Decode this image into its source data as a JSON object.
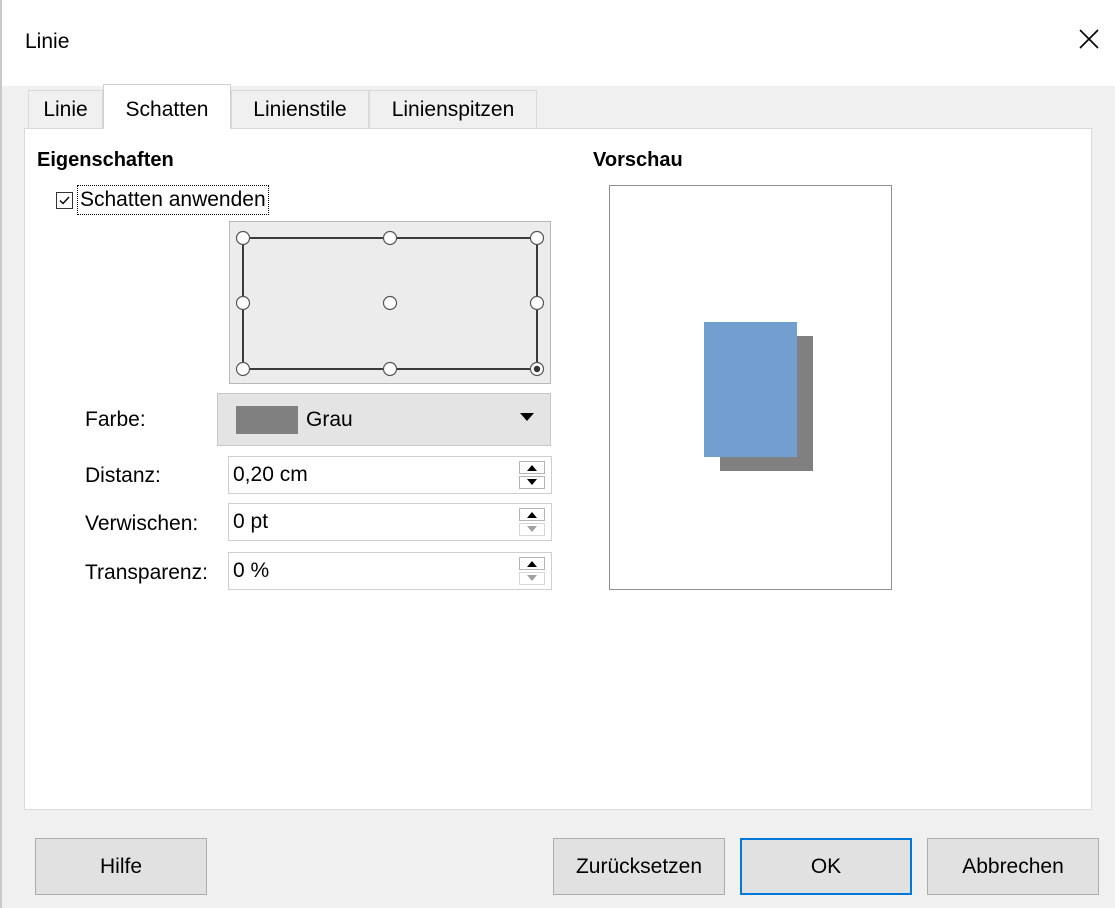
{
  "window": {
    "title": "Linie"
  },
  "tabs": [
    "Linie",
    "Schatten",
    "Linienstile",
    "Linienspitzen"
  ],
  "active_tab": "Schatten",
  "properties": {
    "heading": "Eigenschaften",
    "apply_shadow_label": "Schatten anwenden",
    "apply_shadow_checked": true,
    "position_selected": "bottom-right",
    "color_label": "Farbe:",
    "color_value": "Grau",
    "color_swatch": "#808080",
    "distance_label": "Distanz:",
    "distance_value": "0,20 cm",
    "blur_label": "Verwischen:",
    "blur_value": "0 pt",
    "transparency_label": "Transparenz:",
    "transparency_value": "0 %"
  },
  "preview": {
    "heading": "Vorschau",
    "shape_color": "#729fcf",
    "shadow_color": "#808080"
  },
  "buttons": {
    "help": "Hilfe",
    "reset": "Zurücksetzen",
    "ok": "OK",
    "cancel": "Abbrechen"
  }
}
